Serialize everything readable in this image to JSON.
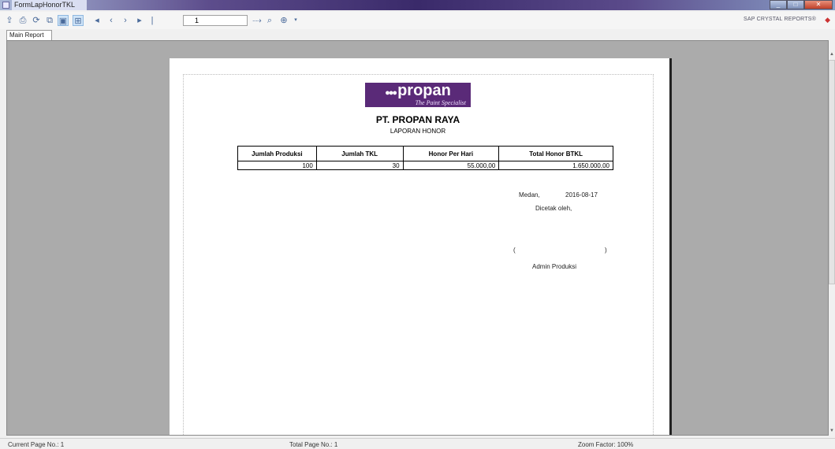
{
  "window": {
    "title": "FormLapHonorTKL"
  },
  "toolbar": {
    "page_value": "1",
    "brand": "SAP CRYSTAL REPORTS®"
  },
  "tabs": [
    "Main Report"
  ],
  "report": {
    "logo_text": "propan",
    "logo_tagline": "The Paint Specialist",
    "company": "PT. PROPAN RAYA",
    "title": "LAPORAN HONOR",
    "table": {
      "headers": [
        "Jumlah Produksi",
        "Jumlah TKL",
        "Honor Per Hari",
        "Total Honor BTKL"
      ],
      "row": [
        "100",
        "30",
        "55.000,00",
        "1.650.000,00"
      ]
    },
    "city": "Medan,",
    "date": "2016-08-17",
    "printed_by": "Dicetak oleh,",
    "paren_open": "(",
    "paren_close": ")",
    "signatory": "Admin Produksi"
  },
  "status": {
    "current_page": "Current Page No.: 1",
    "total_page": "Total Page No.: 1",
    "zoom": "Zoom Factor: 100%"
  }
}
